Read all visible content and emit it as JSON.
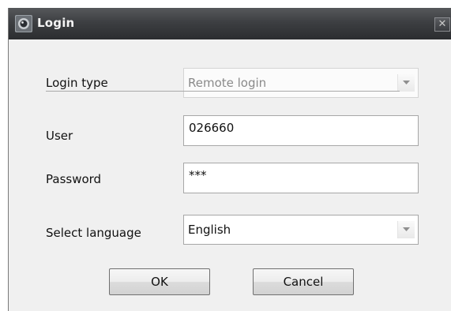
{
  "window": {
    "title": "Login",
    "close_glyph": "✕"
  },
  "form": {
    "login_type": {
      "label": "Login type",
      "value": "Remote login"
    },
    "user": {
      "label": "User",
      "value": "026660"
    },
    "password": {
      "label": "Password",
      "value": "***"
    },
    "language": {
      "label": "Select language",
      "value": "English"
    }
  },
  "buttons": {
    "ok_label": "OK",
    "cancel_label": "Cancel"
  },
  "icons": {
    "app": "camera-app-icon",
    "close": "close-icon",
    "dropdown": "chevron-down-icon"
  },
  "colors": {
    "titlebar": "#3d3f42",
    "window_bg": "#f0f0f0",
    "border": "#a7a7a7"
  }
}
